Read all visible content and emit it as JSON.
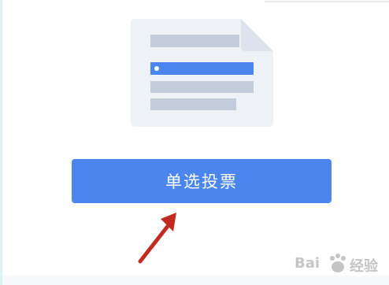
{
  "vote_button": {
    "label": "单选投票"
  },
  "illustration": {
    "icon": "document-single-choice-icon",
    "colors": {
      "paper": "#eef1f6",
      "bar": "#c3ccd9",
      "selected_bar": "#4a86ed"
    }
  },
  "watermark": {
    "text_left": "Bai",
    "text_right": "经验"
  },
  "colors": {
    "accent": "#4a86ed",
    "arrow": "#c22a22"
  }
}
